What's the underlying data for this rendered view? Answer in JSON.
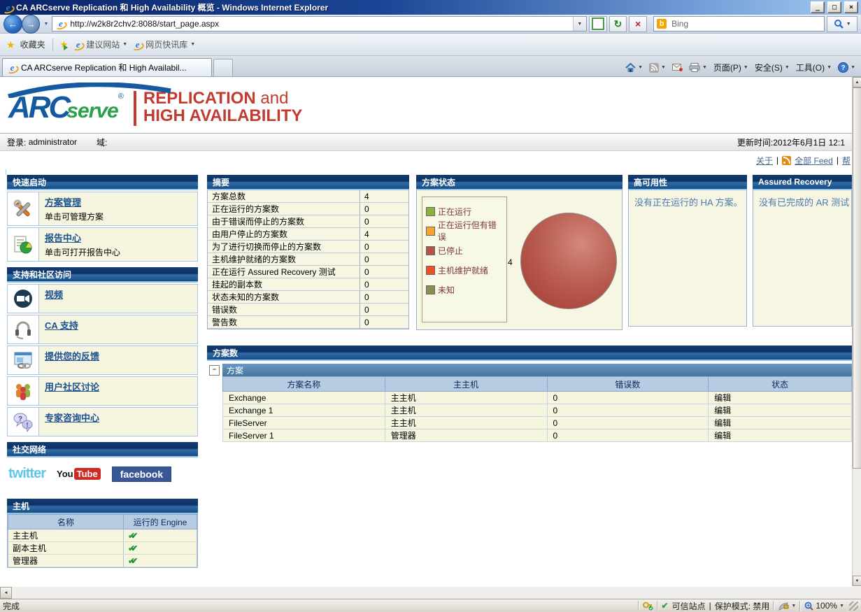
{
  "window": {
    "title": "CA ARCserve Replication 和 High Availability 概览 - Windows Internet Explorer"
  },
  "browser": {
    "address_url": "http://w2k8r2chv2:8088/start_page.aspx",
    "search_engine": "Bing",
    "favorites_bar": {
      "favorites": "收藏夹",
      "suggested_sites": "建议网站",
      "web_slices": "网页快讯库"
    },
    "tab_title": "CA ARCserve Replication 和 High Availabil...",
    "command_bar": {
      "page": "页面(P)",
      "safety": "安全(S)",
      "tools": "工具(O)"
    }
  },
  "logo": {
    "arc": "ARC",
    "serve": "serve",
    "registered": "®",
    "tagline_1a": "REPLICATION",
    "tagline_1b": " and",
    "tagline_2": "HIGH AVAILABILITY"
  },
  "session": {
    "login_label": "登录:",
    "user": "administrator",
    "domain_label": "域:",
    "updated": "更新时间:2012年6月1日 12:1"
  },
  "page_links": {
    "about": "关于",
    "all_feed": "全部 Feed",
    "help": "帮",
    "divider": "|"
  },
  "sidebar": {
    "quick_start": {
      "title": "快速启动",
      "items": [
        {
          "link": "方案管理",
          "desc": "单击可管理方案"
        },
        {
          "link": "报告中心",
          "desc": "单击可打开报告中心"
        }
      ]
    },
    "support": {
      "title": "支持和社区访问",
      "items": [
        {
          "link": "视频"
        },
        {
          "link": "CA 支持"
        },
        {
          "link": "提供您的反馈"
        },
        {
          "link": "用户社区讨论"
        },
        {
          "link": "专家咨询中心"
        }
      ]
    },
    "social": {
      "title": "社交网络",
      "twitter": "twitter",
      "youtube_you": "You",
      "youtube_tube": "Tube",
      "facebook": "facebook",
      "colors": {
        "twitter": "#63c6e8",
        "youtube": "#cc2a24",
        "facebook": "#3a5795"
      }
    },
    "hosts": {
      "title": "主机",
      "columns": [
        "名称",
        "运行的 Engine"
      ],
      "rows": [
        "主主机",
        "副本主机",
        "管理器"
      ]
    }
  },
  "panels": {
    "summary": {
      "title": "摘要",
      "rows": [
        [
          "方案总数",
          "4"
        ],
        [
          "正在运行的方案数",
          "0"
        ],
        [
          "由于错误而停止的方案数",
          "0"
        ],
        [
          "由用户停止的方案数",
          "4"
        ],
        [
          "为了进行切换而停止的方案数",
          "0"
        ],
        [
          "主机维护就绪的方案数",
          "0"
        ],
        [
          "正在运行 Assured Recovery 测试",
          "0"
        ],
        [
          "挂起的副本数",
          "0"
        ],
        [
          "状态未知的方案数",
          "0"
        ],
        [
          "错误数",
          "0"
        ],
        [
          "警告数",
          "0"
        ]
      ]
    },
    "scenario_status": {
      "title": "方案状态",
      "legend": [
        {
          "label": "正在运行",
          "color": "#8ab23c"
        },
        {
          "label": "正在运行但有错误",
          "color": "#f7a232"
        },
        {
          "label": "已停止",
          "color": "#b5524a"
        },
        {
          "label": "主机维护就绪",
          "color": "#ef4f28"
        },
        {
          "label": "未知",
          "color": "#8d8c52"
        }
      ],
      "pie": {
        "type": "pie",
        "labels": [
          "正在运行",
          "正在运行但有错误",
          "已停止",
          "主机维护就绪",
          "未知"
        ],
        "values": [
          0,
          0,
          4,
          0,
          0
        ],
        "value_label": "4",
        "pie_color": "#b5544a"
      }
    },
    "ha": {
      "title": "高可用性",
      "message": "没有正在运行的 HA 方案。"
    },
    "ar": {
      "title": "Assured Recovery",
      "message": "没有已完成的 AR 测试"
    },
    "scenarios": {
      "title": "方案数",
      "group": "方案",
      "columns": [
        "方案名称",
        "主主机",
        "错误数",
        "状态"
      ],
      "rows": [
        [
          "Exchange",
          "主主机",
          "0",
          "编辑"
        ],
        [
          "Exchange 1",
          "主主机",
          "0",
          "编辑"
        ],
        [
          "FileServer",
          "主主机",
          "0",
          "编辑"
        ],
        [
          "FileServer 1",
          "管理器",
          "0",
          "编辑"
        ]
      ]
    }
  },
  "status_bar": {
    "done": "完成",
    "trusted_zone": "可信站点",
    "separator": "|",
    "protected_mode": "保护模式: 禁用",
    "zoom": "100%"
  },
  "glyphs": {
    "minimize": "_",
    "maximize": "□",
    "close": "×",
    "back": "←",
    "forward": "→",
    "dropdown": "▼",
    "refresh": "↻",
    "stop": "×",
    "up": "▲",
    "down": "▼",
    "left": "◄",
    "star": "★",
    "check": "✔",
    "collapse": "−",
    "ie_e": "e",
    "bing_b": "b"
  }
}
